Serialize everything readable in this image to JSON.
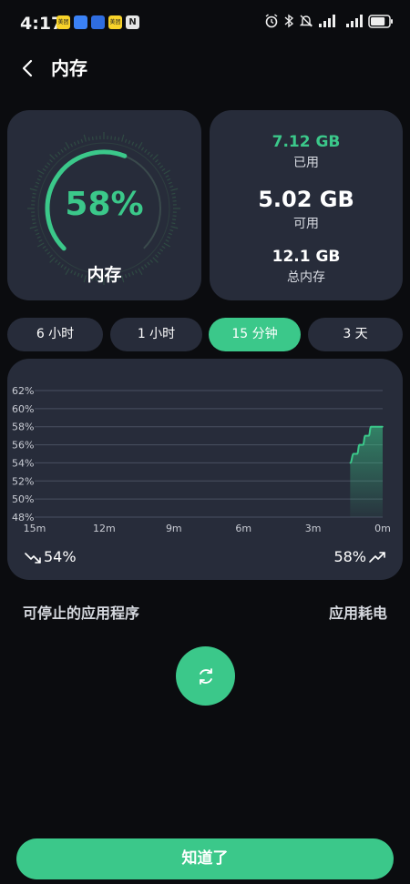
{
  "status_bar": {
    "time": "4:17",
    "apps": [
      {
        "name": "meituan-icon",
        "label": "美团",
        "color": "#f8d32a"
      },
      {
        "name": "blue-app-icon",
        "label": "",
        "color": "#3b82f6"
      },
      {
        "name": "blue-app2-icon",
        "label": "",
        "color": "#2f6de0"
      },
      {
        "name": "meituan2-icon",
        "label": "美团",
        "color": "#f8d32a"
      },
      {
        "name": "nfc-icon",
        "label": "N",
        "color": "#e6e6e6"
      }
    ],
    "battery_level": 0.8
  },
  "header": {
    "title": "内存"
  },
  "gauge": {
    "percent_text": "58%",
    "value": 0.58,
    "label": "内存",
    "accent": "#3bc88a"
  },
  "stats": {
    "used_value": "7.12 GB",
    "used_label": "已用",
    "available_value": "5.02 GB",
    "available_label": "可用",
    "total_value": "12.1 GB",
    "total_label": "总内存"
  },
  "tabs": [
    {
      "label": "6 小时",
      "active": false
    },
    {
      "label": "1 小时",
      "active": false
    },
    {
      "label": "15 分钟",
      "active": true
    },
    {
      "label": "3 天",
      "active": false
    }
  ],
  "chart_data": {
    "type": "area",
    "ylabels": [
      "62%",
      "60%",
      "58%",
      "56%",
      "54%",
      "52%",
      "50%",
      "48%"
    ],
    "xlabels": [
      "15m",
      "12m",
      "9m",
      "6m",
      "3m",
      "0m"
    ],
    "ylim": [
      48,
      62
    ],
    "x": [
      1.4,
      1.25,
      1.1,
      1.0,
      0.85,
      0.75,
      0.6,
      0.5,
      0.4,
      0.3,
      0.0
    ],
    "values": [
      54,
      55,
      55,
      56,
      56,
      57,
      57,
      58,
      58,
      58,
      58
    ],
    "xlim": [
      15,
      0
    ],
    "grid": true,
    "color": "#3bc88a"
  },
  "trend": {
    "start_text": "54%",
    "end_text": "58%"
  },
  "sections": {
    "stoppable_apps": "可停止的应用程序",
    "app_power": "应用耗电"
  },
  "actions": {
    "ok_label": "知道了"
  }
}
